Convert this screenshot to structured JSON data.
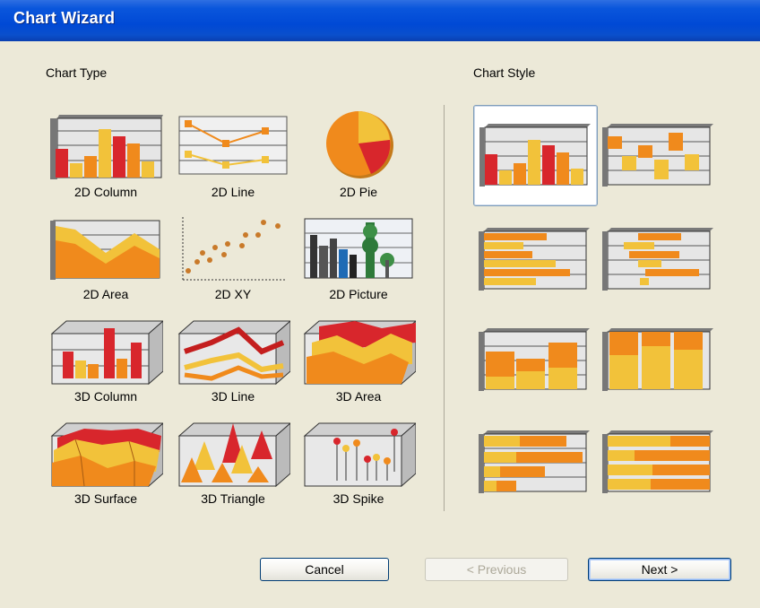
{
  "window": {
    "title": "Chart Wizard"
  },
  "sections": {
    "chart_type_label": "Chart Type",
    "chart_style_label": "Chart Style"
  },
  "chart_types": [
    {
      "label": "2D Column",
      "selected": true
    },
    {
      "label": "2D Line",
      "selected": false
    },
    {
      "label": "2D Pie",
      "selected": false
    },
    {
      "label": "2D Area",
      "selected": false
    },
    {
      "label": "2D XY",
      "selected": false
    },
    {
      "label": "2D Picture",
      "selected": false
    },
    {
      "label": "3D Column",
      "selected": false
    },
    {
      "label": "3D Line",
      "selected": false
    },
    {
      "label": "3D Area",
      "selected": false
    },
    {
      "label": "3D Surface",
      "selected": false
    },
    {
      "label": "3D Triangle",
      "selected": false
    },
    {
      "label": "3D Spike",
      "selected": false
    }
  ],
  "chart_styles": [
    {
      "style": "clustered-column",
      "selected": true
    },
    {
      "style": "3d-floating-column",
      "selected": false
    },
    {
      "style": "clustered-bar",
      "selected": false
    },
    {
      "style": "floating-bar",
      "selected": false
    },
    {
      "style": "stacked-column",
      "selected": false
    },
    {
      "style": "100-percent-stacked-column",
      "selected": false
    },
    {
      "style": "stacked-bar",
      "selected": false
    },
    {
      "style": "100-percent-stacked-bar",
      "selected": false
    }
  ],
  "buttons": {
    "cancel": "Cancel",
    "previous": "< Previous",
    "next": "Next >"
  },
  "colors": {
    "orange": "#f08a1c",
    "yellow": "#f2c23a",
    "red": "#d8262c",
    "title_blue": "#0a4fcc",
    "dialog_bg": "#ece9d8"
  }
}
